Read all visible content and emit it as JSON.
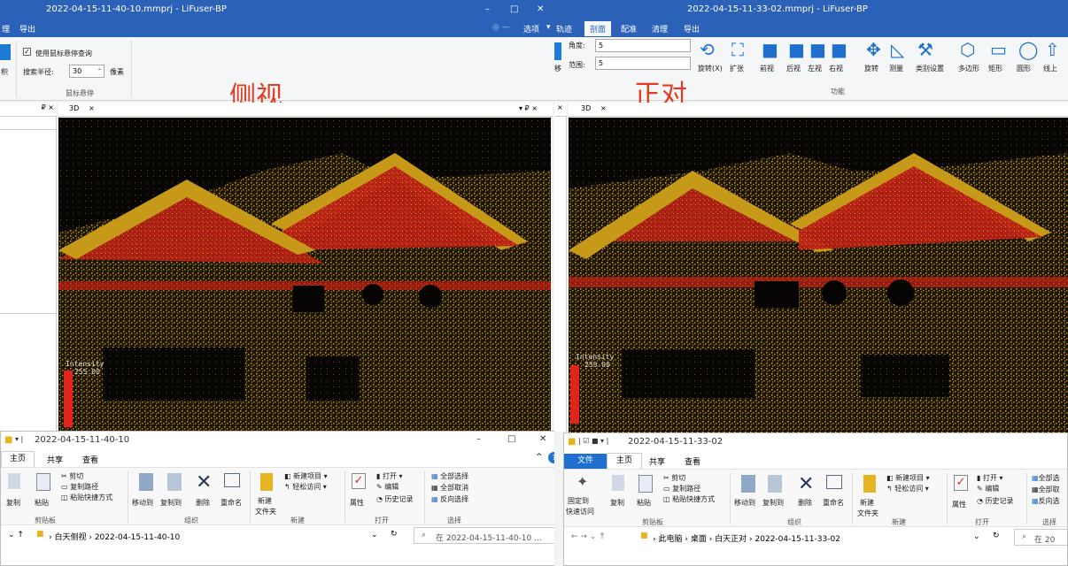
{
  "left": {
    "title": "2022-04-15-11-40-10.mmprj - LiFuser-BP",
    "menu": [
      "理",
      "导出"
    ],
    "options": "选项",
    "ribbon": {
      "checkbox_label": "使用鼠标悬停查询",
      "radius_label": "搜索半径:",
      "radius_value": "30",
      "unit": "像素",
      "partial_left": "积",
      "group_label": "鼠标悬停"
    },
    "overlay_label": "侧视",
    "tab": "3D",
    "tab_close": "×",
    "pin": "▾ ₽ ×",
    "intensity_label": "Intensity",
    "intensity_value": "255.00",
    "explorer": {
      "title": "2022-04-15-11-40-10",
      "tabs": [
        "主页",
        "共享",
        "查看"
      ],
      "cut": "剪切",
      "copy_path": "复制路径",
      "paste_shortcut": "粘贴快捷方式",
      "copy": "复制",
      "paste": "粘贴",
      "move_to": "移动到",
      "copy_to": "复制到",
      "delete": "删除",
      "rename": "重命名",
      "new_item": "新建项目",
      "easy_access": "轻松访问",
      "new_folder": "新建文件夹",
      "new_folder_l1": "新建",
      "new_folder_l2": "文件夹",
      "properties": "属性",
      "open": "打开",
      "edit": "编辑",
      "history": "历史记录",
      "select_all": "全部选择",
      "select_none": "全部取消",
      "invert": "反向选择",
      "groups": [
        "剪贴板",
        "组织",
        "新建",
        "打开",
        "选择"
      ],
      "path": [
        "白天侧视",
        "2022-04-15-11-40-10"
      ],
      "search": "在 2022-04-15-11-40-10 ..."
    }
  },
  "right": {
    "title": "2022-04-15-11-33-02.mmprj - LiFuser-BP",
    "menu": [
      "轨迹",
      "剖面",
      "配准",
      "清理",
      "导出"
    ],
    "active_menu": "剖面",
    "ribbon": {
      "angle_label": "角度:",
      "angle_value": "5",
      "range_label": "范围:",
      "range_value": "5",
      "partial_left": "移",
      "buttons": [
        "旋转(X)",
        "扩张",
        "前视",
        "后视",
        "左视",
        "右视",
        "旋转",
        "测量",
        "类别设置",
        "多边形",
        "矩形",
        "圆形",
        "线上"
      ],
      "group_label": "功能"
    },
    "overlay_label": "正对",
    "tab": "3D",
    "tab_close": "×",
    "intensity_label": "Intensity",
    "intensity_value": "255.00",
    "explorer": {
      "title": "2022-04-15-11-33-02",
      "tabs": [
        "文件",
        "主页",
        "共享",
        "查看"
      ],
      "pin": "固定到",
      "quick": "快速访问",
      "copy": "复制",
      "paste": "粘贴",
      "cut": "剪切",
      "copy_path": "复制路径",
      "paste_shortcut": "粘贴快捷方式",
      "move_to": "移动到",
      "copy_to": "复制到",
      "delete": "删除",
      "rename": "重命名",
      "new_item": "新建项目",
      "easy_access": "轻松访问",
      "new_folder_l1": "新建",
      "new_folder_l2": "文件夹",
      "properties": "属性",
      "open": "打开",
      "edit": "编辑",
      "history": "历史记录",
      "select_all": "全部选",
      "select_none": "全部取",
      "invert": "反向选",
      "groups": [
        "剪贴板",
        "组织",
        "新建",
        "打开",
        "选择"
      ],
      "path": [
        "此电脑",
        "桌面",
        "白天正对",
        "2022-04-15-11-33-02"
      ],
      "search": "在 20"
    }
  },
  "colors": {
    "title_blue": "#2b62b8",
    "accent_red": "#e53a1f",
    "scene_red": "#d8291e",
    "scene_yellow": "#c9a21a"
  }
}
